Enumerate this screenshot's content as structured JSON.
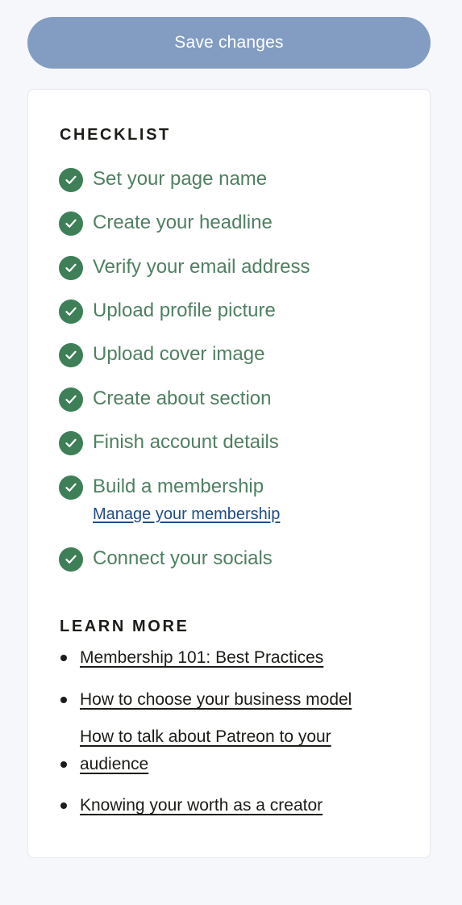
{
  "save_button": {
    "label": "Save changes"
  },
  "checklist": {
    "heading": "CHECKLIST",
    "items": [
      {
        "label": "Set your page name",
        "checked": true
      },
      {
        "label": "Create your headline",
        "checked": true
      },
      {
        "label": "Verify your email address",
        "checked": true
      },
      {
        "label": "Upload profile picture",
        "checked": true
      },
      {
        "label": "Upload cover image",
        "checked": true
      },
      {
        "label": "Create about section",
        "checked": true
      },
      {
        "label": "Finish account details",
        "checked": true
      },
      {
        "label": "Build a membership",
        "checked": true,
        "link": "Manage your membership"
      },
      {
        "label": "Connect your socials",
        "checked": true
      }
    ]
  },
  "learn_more": {
    "heading": "LEARN MORE",
    "links": [
      "Membership 101: Best Practices",
      "How to choose your business model",
      "How to talk about Patreon to your audience",
      "Knowing your worth as a creator"
    ]
  },
  "colors": {
    "page_background": "#f6f7fb",
    "save_button": "#839dc2",
    "check_green": "#3e7f58",
    "check_text": "#4f8062",
    "link_blue": "#1e4c88",
    "heading_text": "#1d1c18"
  },
  "icons": {
    "check": "check-circle-icon",
    "bullet": "bullet-dot-icon"
  }
}
